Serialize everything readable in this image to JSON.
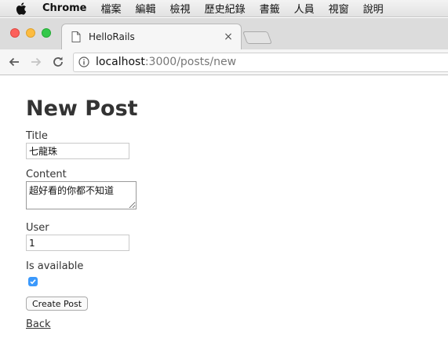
{
  "menubar": {
    "app_name": "Chrome",
    "items": [
      "檔案",
      "編輯",
      "檢視",
      "歷史紀錄",
      "書籤",
      "人員",
      "視窗",
      "說明"
    ]
  },
  "browser": {
    "tab_title": "HelloRails",
    "tab_close": "×",
    "url_host": "localhost",
    "url_rest": ":3000/posts/new"
  },
  "page": {
    "heading": "New Post",
    "title_label": "Title",
    "title_value": "七龍珠",
    "content_label": "Content",
    "content_value": "超好看的你都不知道",
    "user_label": "User",
    "user_value": "1",
    "available_label": "Is available",
    "available_checked": true,
    "submit_label": "Create Post",
    "back_label": "Back"
  },
  "colors": {
    "checkbox_accent": "#3b99fc",
    "traffic_red": "#fc605b",
    "traffic_yellow": "#fdbc40",
    "traffic_green": "#34c84a"
  }
}
